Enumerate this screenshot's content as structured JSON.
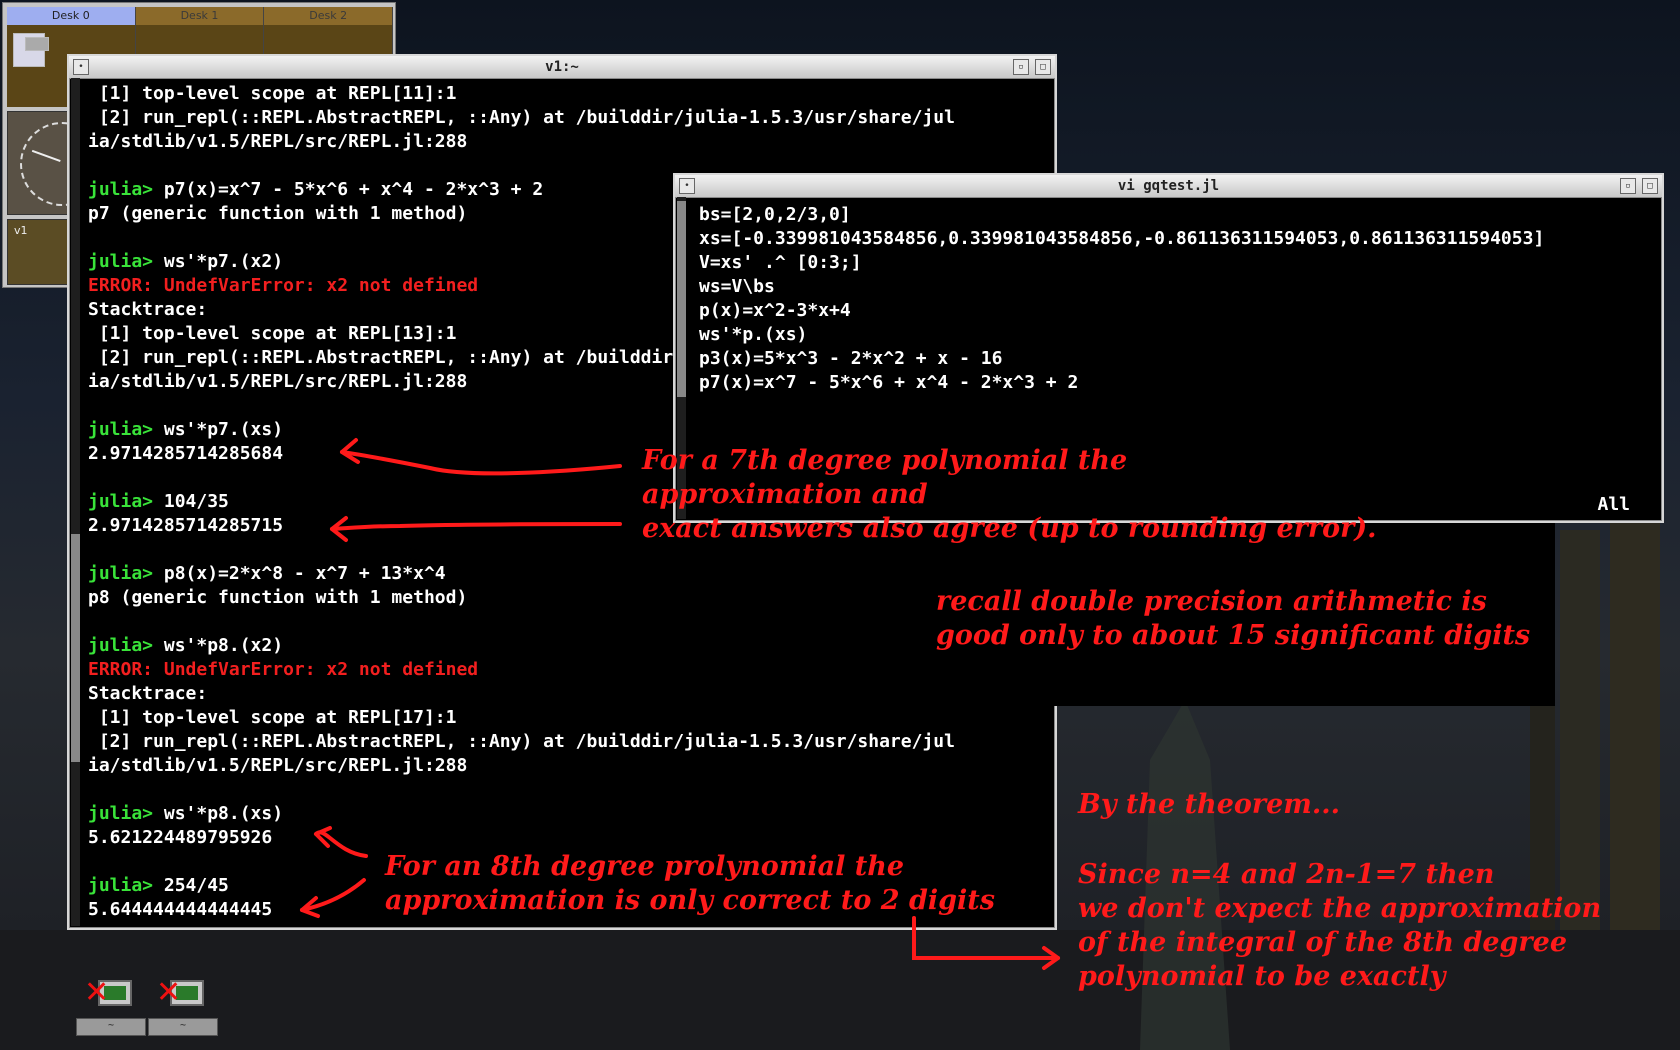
{
  "pager": {
    "desks": [
      "Desk 0",
      "Desk 1",
      "Desk 2"
    ],
    "active_desk": 0,
    "mail_label": "v1"
  },
  "repl_window": {
    "title": "v1:~",
    "lines": [
      [
        {
          "t": " [1] top-level scope at REPL[11]:1",
          "c": "out"
        }
      ],
      [
        {
          "t": " [2] run_repl(::REPL.AbstractREPL, ::Any) at /builddir/julia-1.5.3/usr/share/jul",
          "c": "out"
        }
      ],
      [
        {
          "t": "ia/stdlib/v1.5/REPL/src/REPL.jl:288",
          "c": "out"
        }
      ],
      [],
      [
        {
          "t": "julia> ",
          "c": "prompt"
        },
        {
          "t": "p7(x)=x^7 - 5*x^6 + x^4 - 2*x^3 + 2",
          "c": "out"
        }
      ],
      [
        {
          "t": "p7 (generic function with 1 method)",
          "c": "out"
        }
      ],
      [],
      [
        {
          "t": "julia> ",
          "c": "prompt"
        },
        {
          "t": "ws'*p7.(x2)",
          "c": "out"
        }
      ],
      [
        {
          "t": "ERROR: UndefVarError: x2 not defined",
          "c": "err"
        }
      ],
      [
        {
          "t": "Stacktrace:",
          "c": "out"
        }
      ],
      [
        {
          "t": " [1] top-level scope at REPL[13]:1",
          "c": "out"
        }
      ],
      [
        {
          "t": " [2] run_repl(::REPL.AbstractREPL, ::Any) at /builddir/julia-1.5.3/usr/share/jul",
          "c": "out"
        }
      ],
      [
        {
          "t": "ia/stdlib/v1.5/REPL/src/REPL.jl:288",
          "c": "out"
        }
      ],
      [],
      [
        {
          "t": "julia> ",
          "c": "prompt"
        },
        {
          "t": "ws'*p7.(xs)",
          "c": "out"
        }
      ],
      [
        {
          "t": "2.9714285714285684",
          "c": "out"
        }
      ],
      [],
      [
        {
          "t": "julia> ",
          "c": "prompt"
        },
        {
          "t": "104/35",
          "c": "out"
        }
      ],
      [
        {
          "t": "2.9714285714285715",
          "c": "out"
        }
      ],
      [],
      [
        {
          "t": "julia> ",
          "c": "prompt"
        },
        {
          "t": "p8(x)=2*x^8 - x^7 + 13*x^4",
          "c": "out"
        }
      ],
      [
        {
          "t": "p8 (generic function with 1 method)",
          "c": "out"
        }
      ],
      [],
      [
        {
          "t": "julia> ",
          "c": "prompt"
        },
        {
          "t": "ws'*p8.(x2)",
          "c": "out"
        }
      ],
      [
        {
          "t": "ERROR: UndefVarError: x2 not defined",
          "c": "err"
        }
      ],
      [
        {
          "t": "Stacktrace:",
          "c": "out"
        }
      ],
      [
        {
          "t": " [1] top-level scope at REPL[17]:1",
          "c": "out"
        }
      ],
      [
        {
          "t": " [2] run_repl(::REPL.AbstractREPL, ::Any) at /builddir/julia-1.5.3/usr/share/jul",
          "c": "out"
        }
      ],
      [
        {
          "t": "ia/stdlib/v1.5/REPL/src/REPL.jl:288",
          "c": "out"
        }
      ],
      [],
      [
        {
          "t": "julia> ",
          "c": "prompt"
        },
        {
          "t": "ws'*p8.(xs)",
          "c": "out"
        }
      ],
      [
        {
          "t": "5.621224489795926",
          "c": "out"
        }
      ],
      [],
      [
        {
          "t": "julia> ",
          "c": "prompt"
        },
        {
          "t": "254/45",
          "c": "out"
        }
      ],
      [
        {
          "t": "5.644444444444445",
          "c": "out"
        }
      ]
    ]
  },
  "vi_window": {
    "title": "vi gqtest.jl",
    "lines": [
      "bs=[2,0,2/3,0]",
      "xs=[-0.339981043584856,0.339981043584856,-0.861136311594053,0.861136311594053]",
      "V=xs' .^ [0:3;]",
      "ws=V\\bs",
      "p(x)=x^2-3*x+4",
      "ws'*p.(xs)",
      "p3(x)=5*x^3 - 2*x^2 + x - 16",
      "p7(x)=x^7 - 5*x^6 + x^4 - 2*x^3 + 2"
    ],
    "status": "All"
  },
  "annotations": {
    "n1": "For a 7th degree polynomial the\napproximation and\nexact answers also agree (up to rounding error).",
    "n2": "recall double precision arithmetic is\ngood only to about 15 significant digits",
    "n3": "For an 8th degree prolynomial the\napproximation is only correct to 2 digits",
    "n4": "By the theorem...",
    "n5": "Since n=4 and 2n-1=7 then\nwe don't expect the approximation\nof the integral of the 8th degree\npolynomial to be exactly"
  },
  "desktop_icons": [
    {
      "label": "~",
      "icon": "terminal-computer-icon"
    },
    {
      "label": "~",
      "icon": "terminal-computer-icon"
    }
  ],
  "colors": {
    "prompt": "#39e339",
    "error": "#f21f1f",
    "annotation": "#ff1a1a"
  }
}
